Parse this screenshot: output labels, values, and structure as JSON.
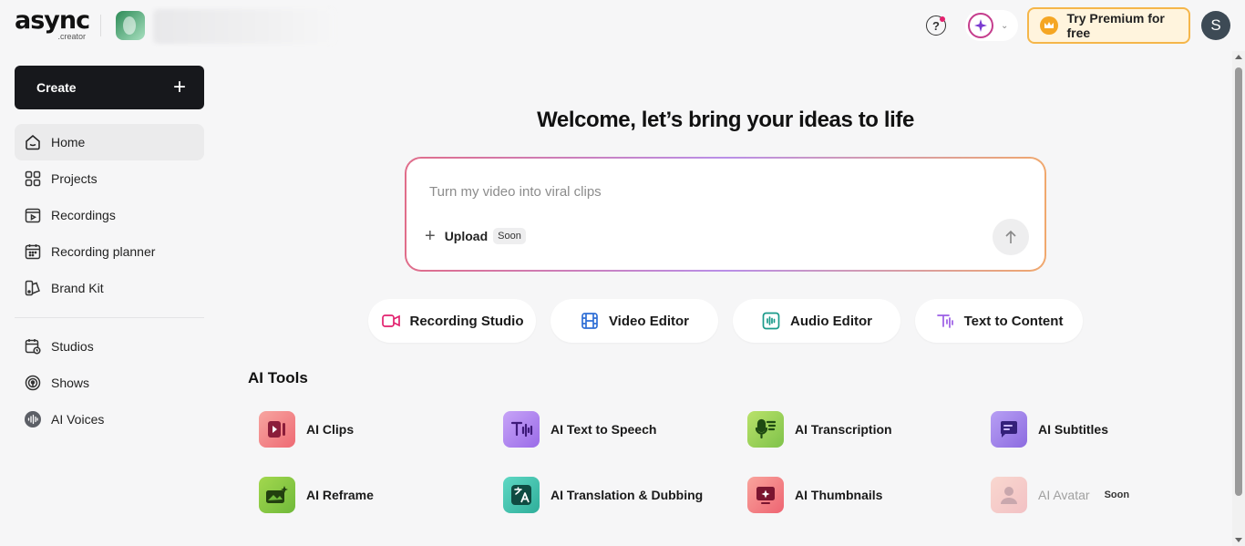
{
  "header": {
    "logo_text": "async",
    "logo_sub": ".creator",
    "premium_label": "Try Premium for free",
    "user_initial": "S"
  },
  "sidebar": {
    "create_label": "Create",
    "items": [
      {
        "label": "Home",
        "icon": "home-icon",
        "active": true
      },
      {
        "label": "Projects",
        "icon": "grid-icon"
      },
      {
        "label": "Recordings",
        "icon": "recordings-icon"
      },
      {
        "label": "Recording planner",
        "icon": "calendar-icon"
      },
      {
        "label": "Brand Kit",
        "icon": "brand-kit-icon"
      }
    ],
    "items2": [
      {
        "label": "Studios",
        "icon": "studios-icon"
      },
      {
        "label": "Shows",
        "icon": "podcast-icon"
      },
      {
        "label": "AI Voices",
        "icon": "voice-wave-icon"
      }
    ]
  },
  "main": {
    "welcome": "Welcome, let’s bring your ideas to life",
    "prompt_placeholder": "Turn my video into viral clips",
    "upload_label": "Upload",
    "upload_badge": "Soon",
    "quick_actions": [
      {
        "label": "Recording Studio",
        "icon": "video-camera-icon",
        "color": "#e2216e"
      },
      {
        "label": "Video Editor",
        "icon": "film-icon",
        "color": "#2f6fd6"
      },
      {
        "label": "Audio Editor",
        "icon": "audio-wave-icon",
        "color": "#1a9a8a"
      },
      {
        "label": "Text to Content",
        "icon": "text-wave-icon",
        "color": "#9b5de5"
      }
    ],
    "tools_title": "AI Tools",
    "tools": [
      {
        "label": "AI Clips",
        "icon": "clips-icon"
      },
      {
        "label": "AI Text to Speech",
        "icon": "speech-icon"
      },
      {
        "label": "AI Transcription",
        "icon": "microphone-icon"
      },
      {
        "label": "AI Subtitles",
        "icon": "subtitles-icon"
      },
      {
        "label": "AI Reframe",
        "icon": "reframe-icon"
      },
      {
        "label": "AI Translation & Dubbing",
        "icon": "translate-icon"
      },
      {
        "label": "AI Thumbnails",
        "icon": "thumbnail-icon"
      },
      {
        "label": "AI Avatar",
        "icon": "avatar-icon",
        "badge": "Soon",
        "disabled": true
      }
    ]
  }
}
